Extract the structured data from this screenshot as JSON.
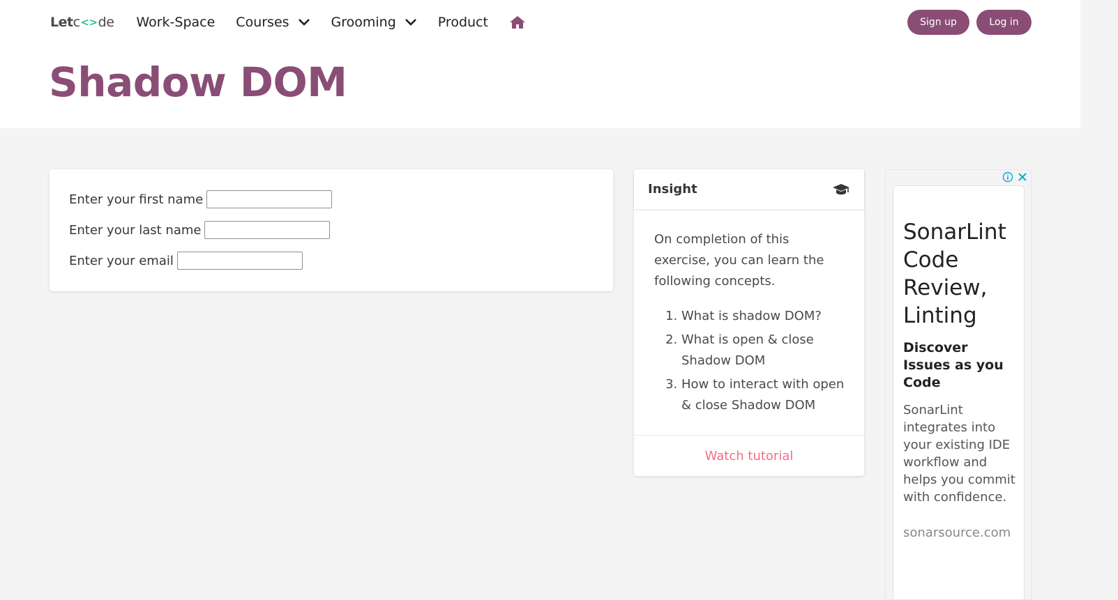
{
  "nav": {
    "logo_prefix": "Let",
    "logo_o": "c<>",
    "logo_suffix": "de",
    "items": [
      {
        "label": "Work-Space"
      },
      {
        "label": "Courses"
      },
      {
        "label": "Grooming"
      },
      {
        "label": "Product"
      }
    ],
    "signup_label": "Sign up",
    "login_label": "Log in"
  },
  "page": {
    "title": "Shadow DOM"
  },
  "form": {
    "first_name_label": "Enter your first name",
    "last_name_label": "Enter your last name",
    "email_label": "Enter your email",
    "first_name_value": "",
    "last_name_value": "",
    "email_value": ""
  },
  "insight": {
    "title": "Insight",
    "intro": "On completion of this exercise, you can learn the following concepts.",
    "items": [
      "What is shadow DOM?",
      "What is open & close Shadow DOM",
      "How to interact with open & close Shadow DOM"
    ],
    "footer_link": "Watch tutorial"
  },
  "ad": {
    "headline": "SonarLint Code Review, Linting",
    "subhead": "Discover Issues as you Code",
    "body": "SonarLint integrates into your existing IDE workflow and helps you commit with confidence.",
    "url": "sonarsource.com"
  },
  "colors": {
    "brand": "#8a4d76",
    "link": "#f26d89",
    "logo_accent": "#22c38e",
    "ad_icon": "#00aecd"
  }
}
